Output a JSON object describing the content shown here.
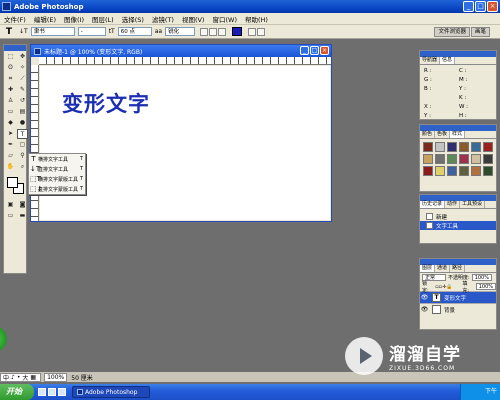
{
  "app": {
    "title": "Adobe Photoshop"
  },
  "menu": [
    "文件(F)",
    "编辑(E)",
    "图像(I)",
    "图层(L)",
    "选择(S)",
    "滤镜(T)",
    "视图(V)",
    "窗口(W)",
    "帮助(H)"
  ],
  "options": {
    "tool_glyph": "T",
    "orient_glyph": "↓T",
    "font_family": "隶书",
    "font_style": "-",
    "size_glyph": "tT",
    "font_size": "60 点",
    "aa_glyph": "aa",
    "anti_alias": "锐化",
    "text_color": "#1b1bb8",
    "tabs": [
      "文件浏览器",
      "画笔"
    ]
  },
  "document": {
    "title": "未标题-1 @ 100% (变形文字, RGB)",
    "canvas_text": "变形文字",
    "canvas_text_color": "#1c2fb2"
  },
  "flyout": [
    {
      "icon": "T",
      "label": "横排文字工具",
      "key": "T"
    },
    {
      "icon": "↓T",
      "label": "直排文字工具",
      "key": "T"
    },
    {
      "icon": "⬚T",
      "label": "横排文字蒙版工具",
      "key": "T"
    },
    {
      "icon": "⬚↓",
      "label": "直排文字蒙版工具",
      "key": "T"
    }
  ],
  "panels": {
    "navigator_tabs": [
      "导航器",
      "信息"
    ],
    "info_labels": [
      "R :",
      "C :",
      "G :",
      "M :",
      "B :",
      "Y :",
      "",
      "K :",
      "X :",
      "W :",
      "Y :",
      "H :"
    ],
    "swatch_tabs": [
      "颜色",
      "色板",
      "样式"
    ],
    "swatches": [
      "#7a2a1a",
      "#c3c3c3",
      "#2f2f6f",
      "#8a5a2a",
      "#3a6a9a",
      "#9a2020",
      "#c8a060",
      "#707070",
      "#5a8a5a",
      "#a03050",
      "#d0c0a0",
      "#3a3a3a",
      "#8c1c1c",
      "#e0d070",
      "#4060a0",
      "#606040",
      "#b07040",
      "#2c4c2c"
    ],
    "history_tabs": [
      "历史记录",
      "动作",
      "工具预设"
    ],
    "history_items": [
      "新建",
      "文字工具"
    ],
    "layers_tabs": [
      "图层",
      "通道",
      "路径"
    ],
    "blend_mode": "正常",
    "opacity_label": "不透明度:",
    "opacity": "100%",
    "lock_label": "锁定:",
    "fill_label": "填充:",
    "fill": "100%",
    "layers": [
      {
        "thumb": "T",
        "name": "变形文字"
      },
      {
        "thumb": "",
        "name": "背景"
      }
    ]
  },
  "statusbar": {
    "ime": [
      "中",
      "♪",
      "•",
      "大",
      "▦"
    ],
    "zoom": "100%",
    "doc_info": "50 厘米"
  },
  "taskbar": {
    "start": "开始",
    "task": "Adobe Photoshop",
    "clock": "下午"
  },
  "watermark": {
    "main": "溜溜自学",
    "sub": "ZIXUE.3D66.COM"
  }
}
